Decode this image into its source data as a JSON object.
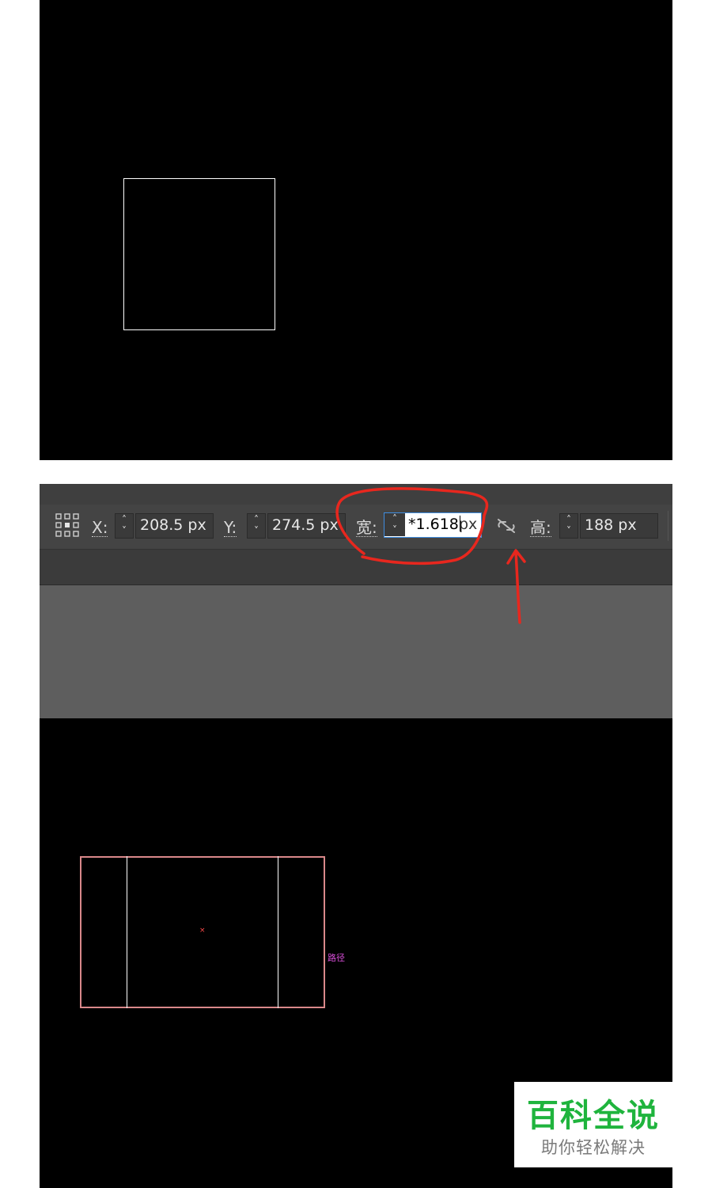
{
  "toolbar": {
    "x_label": "X:",
    "x_value": "208.5 px",
    "y_label": "Y:",
    "y_value": "274.5 px",
    "w_label": "宽:",
    "w_value": "*1.618",
    "w_unit": "px",
    "h_label": "高:",
    "h_value": "188 px"
  },
  "spin": {
    "up": "˄",
    "down": "˅"
  },
  "canvas": {
    "path_label": "路径",
    "center_mark": "×"
  },
  "watermark": {
    "title": "百科全说",
    "subtitle": "助你轻松解决"
  },
  "icons": {
    "anchor": "anchor-grid-icon",
    "link": "unlink-chain-icon",
    "annotation": "red-circle-and-arrow"
  },
  "colors": {
    "canvas_bg": "#000000",
    "toolbar_bg": "#444444",
    "focus_border": "#3f8de0",
    "selection_outline": "#d9888a",
    "annotation_red": "#e8271e",
    "watermark_green": "#1fb43d"
  }
}
